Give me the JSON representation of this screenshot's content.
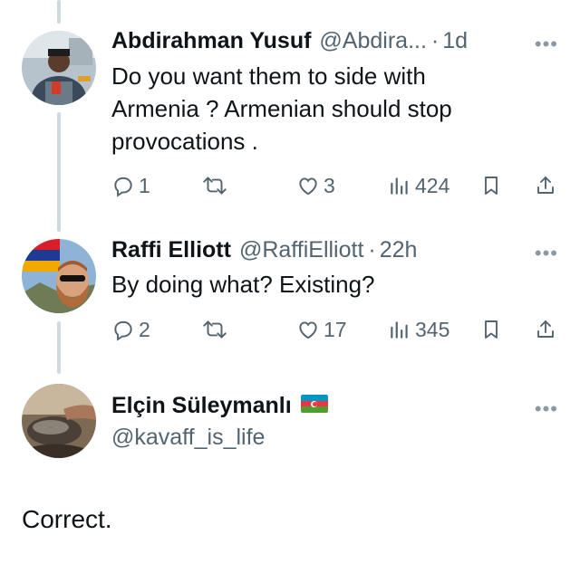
{
  "tweets": [
    {
      "name": "Abdirahman Yusuf",
      "handle": "@Abdira...",
      "sep": "·",
      "time": "1d",
      "text": "Do you want them to side with Armenia ?  Armenian should stop provocations .",
      "replies": "1",
      "retweets": "",
      "likes": "3",
      "views": "424"
    },
    {
      "name": "Raffi Elliott",
      "handle": "@RaffiElliott",
      "sep": "·",
      "time": "22h",
      "text": "By doing what? Existing?",
      "replies": "2",
      "retweets": "",
      "likes": "17",
      "views": "345"
    }
  ],
  "main_tweet": {
    "name": "Elçin Süleymanlı",
    "handle": "@kavaff_is_life",
    "text": "Correct."
  },
  "more_glyph": "•••",
  "colors": {
    "text": "#0f1419",
    "secondary": "#536471",
    "thread_line": "#cfd9de",
    "flag_blue": "#0098c3",
    "flag_red": "#ef3340",
    "flag_green": "#509e2f"
  }
}
